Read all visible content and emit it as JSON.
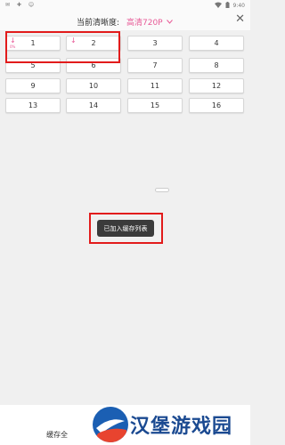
{
  "status_bar": {
    "left_icons": [
      "message-icon",
      "app-icon",
      "wechat-icon"
    ],
    "time": "9:40"
  },
  "header": {
    "resolution_label": "当前清晰度:",
    "resolution_value": "高清720P",
    "close_icon": "close-icon"
  },
  "episodes": [
    {
      "label": "1",
      "downloading": true
    },
    {
      "label": "2",
      "downloading": true
    },
    {
      "label": "3"
    },
    {
      "label": "4"
    },
    {
      "label": "5"
    },
    {
      "label": "6"
    },
    {
      "label": "7"
    },
    {
      "label": "8"
    },
    {
      "label": "9"
    },
    {
      "label": "10"
    },
    {
      "label": "11"
    },
    {
      "label": "12"
    },
    {
      "label": "13"
    },
    {
      "label": "14"
    },
    {
      "label": "15"
    },
    {
      "label": "16"
    }
  ],
  "download_progress": "0%",
  "toast": "已加入缓存列表",
  "bottom": {
    "cache_all_label": "缓存全"
  },
  "watermark": {
    "text": "汉堡游戏园"
  },
  "colors": {
    "accent": "#e85a97",
    "highlight": "#e21b1b",
    "toast_bg": "#3b3b3b"
  }
}
